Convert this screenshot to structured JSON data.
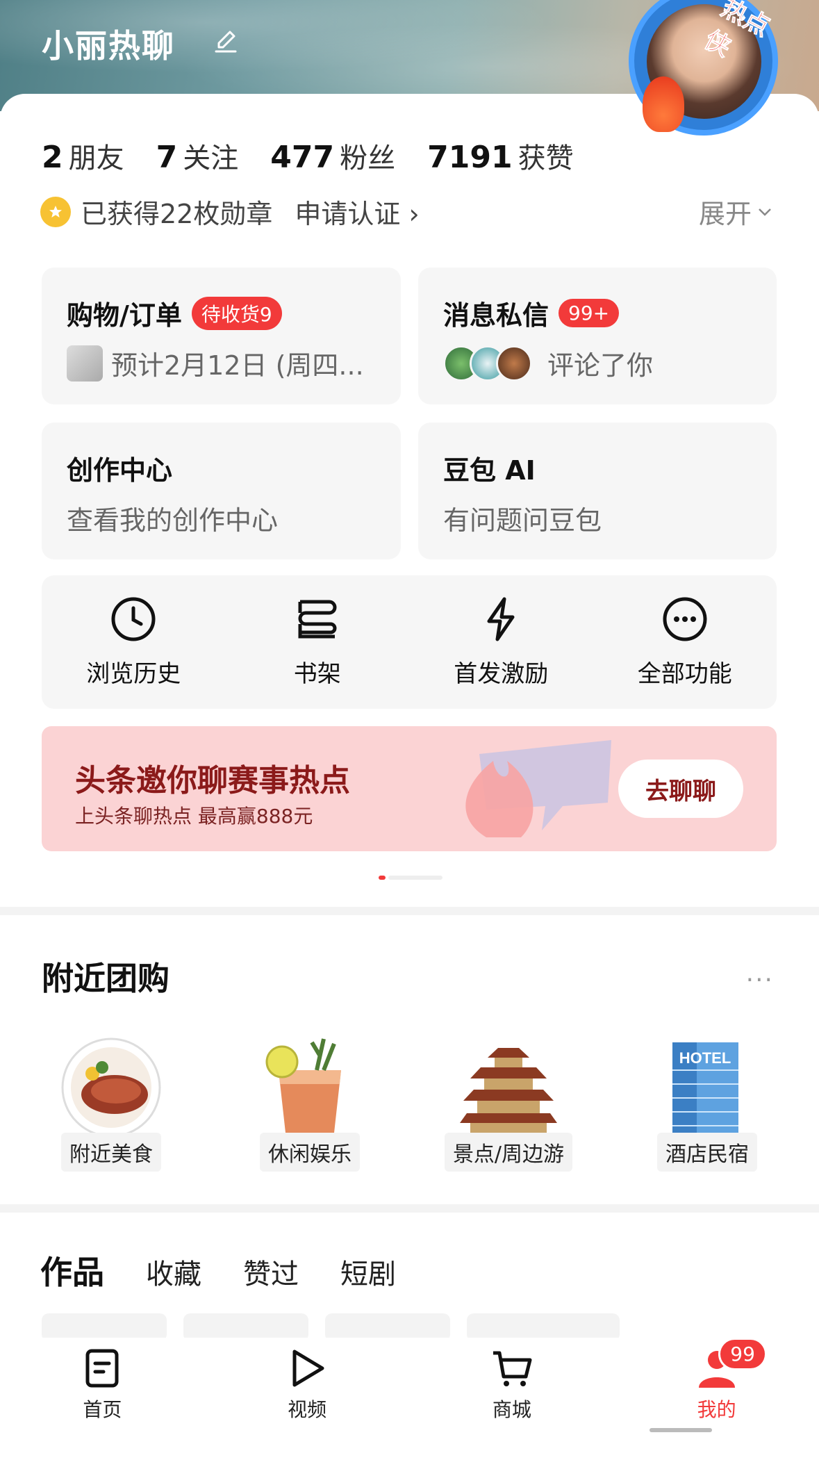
{
  "profile": {
    "username": "小丽热聊",
    "avatar_badge": "热点侠",
    "stats": [
      {
        "num": "2",
        "label": "朋友"
      },
      {
        "num": "7",
        "label": "关注"
      },
      {
        "num": "477",
        "label": "粉丝"
      },
      {
        "num": "7191",
        "label": "获赞"
      }
    ],
    "medals_text": "已获得22枚勋章",
    "verify_text": "申请认证",
    "expand_text": "展开"
  },
  "cards": {
    "shopping": {
      "title": "购物/订单",
      "badge": "待收货9",
      "sub": "预计2月12日 (周四..."
    },
    "messages": {
      "title": "消息私信",
      "badge": "99+",
      "sub": "评论了你"
    },
    "creator": {
      "title": "创作中心",
      "sub": "查看我的创作中心"
    },
    "doubao": {
      "title": "豆包 AI",
      "sub": "有问题问豆包"
    }
  },
  "tools": [
    {
      "label": "浏览历史",
      "icon": "clock-icon"
    },
    {
      "label": "书架",
      "icon": "bookshelf-icon"
    },
    {
      "label": "首发激励",
      "icon": "lightning-icon"
    },
    {
      "label": "全部功能",
      "icon": "more-circle-icon"
    }
  ],
  "banner": {
    "title": "头条邀你聊赛事热点",
    "subtitle": "上头条聊热点 最高赢888元",
    "button": "去聊聊"
  },
  "groupbuy": {
    "title": "附近团购",
    "items": [
      {
        "label": "附近美食"
      },
      {
        "label": "休闲娱乐"
      },
      {
        "label": "景点/周边游"
      },
      {
        "label": "酒店民宿"
      }
    ],
    "hotel_sign": "HOTEL"
  },
  "content_tabs": [
    "作品",
    "收藏",
    "赞过",
    "短剧"
  ],
  "bottom_nav": {
    "items": [
      {
        "label": "首页",
        "icon": "home-doc-icon"
      },
      {
        "label": "视频",
        "icon": "play-icon"
      },
      {
        "label": "商城",
        "icon": "cart-icon"
      },
      {
        "label": "我的",
        "icon": "profile-icon"
      }
    ],
    "badge": "99"
  },
  "colors": {
    "accent": "#f23a3a",
    "banner_bg": "#fbd3d4",
    "banner_text": "#8b1a1a"
  }
}
